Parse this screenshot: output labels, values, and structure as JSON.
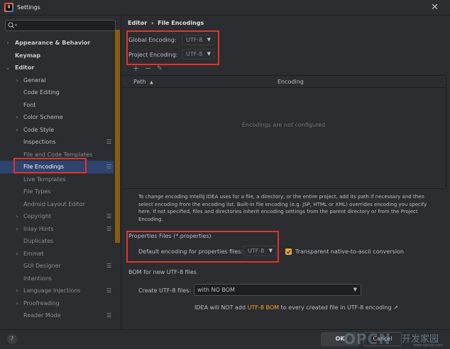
{
  "window": {
    "title": "Settings",
    "app_icon_text": "IJ"
  },
  "sidebar": {
    "search_placeholder": "",
    "items": [
      {
        "label": "Appearance & Behavior",
        "arrow": "›"
      },
      {
        "label": "Keymap"
      },
      {
        "label": "Editor",
        "arrow": "⌄"
      },
      {
        "label": "General",
        "arrow": "›"
      },
      {
        "label": "Code Editing"
      },
      {
        "label": "Font"
      },
      {
        "label": "Color Scheme",
        "arrow": "›"
      },
      {
        "label": "Code Style",
        "arrow": "›"
      },
      {
        "label": "Inspections"
      },
      {
        "label": "File and Code Templates"
      },
      {
        "label": "File Encodings"
      },
      {
        "label": "Live Templates"
      },
      {
        "label": "File Types"
      },
      {
        "label": "Android Layout Editor"
      },
      {
        "label": "Copyright",
        "arrow": "›"
      },
      {
        "label": "Inlay Hints",
        "arrow": "›"
      },
      {
        "label": "Duplicates"
      },
      {
        "label": "Emmet",
        "arrow": "›"
      },
      {
        "label": "GUI Designer"
      },
      {
        "label": "Intentions"
      },
      {
        "label": "Language Injections",
        "arrow": "›"
      },
      {
        "label": "Proofreading",
        "arrow": "›"
      },
      {
        "label": "Reader Mode"
      }
    ]
  },
  "main": {
    "breadcrumb_parent": "Editor",
    "breadcrumb_sep": "›",
    "breadcrumb_current": "File Encodings",
    "global_encoding_label": "Global Encoding:",
    "global_encoding_value": "UTF-8",
    "project_encoding_label": "Project Encoding:",
    "project_encoding_value": "UTF-8",
    "toolbar": {
      "add": "+",
      "remove": "−",
      "edit": "✎"
    },
    "table": {
      "col_path": "Path",
      "col_path_sort": "▲",
      "col_encoding": "Encoding",
      "empty_text": "Encodings are not configured"
    },
    "description": "To change encoding IntelliJ IDEA uses for a file, a directory, or the entire project, add its path if necessary and then select encoding from the encoding list. Built-in file encoding (e.g. JSP, HTML or XML) overrides encoding you specify here. If not specified, files and directories inherit encoding settings from the parent directory or from the Project Encoding.",
    "properties": {
      "section_title": "Properties Files (*.properties)",
      "default_label": "Default encoding for properties files:",
      "default_value": "UTF-8",
      "transparent_label": "Transparent native-to-ascii conversion",
      "transparent_checked": true
    },
    "bom": {
      "section_title": "BOM for new UTF-8 files",
      "create_label": "Create UTF-8 files:",
      "create_value": "with NO BOM",
      "info_prefix": "IDEA will NOT add",
      "info_link": "UTF-8 BOM",
      "info_suffix": "to every created file in UTF-8 encoding ↗"
    }
  },
  "footer": {
    "help": "?",
    "ok": "OK",
    "cancel": "Cancel"
  },
  "watermark": {
    "brand": "OPCN",
    "cn": "开发家园",
    "url": "www.opcnjs.com"
  },
  "colors": {
    "accent_red_box": "#e5322d",
    "selection": "#2e436e",
    "link": "#f5a623",
    "checkbox": "#f0a732"
  }
}
